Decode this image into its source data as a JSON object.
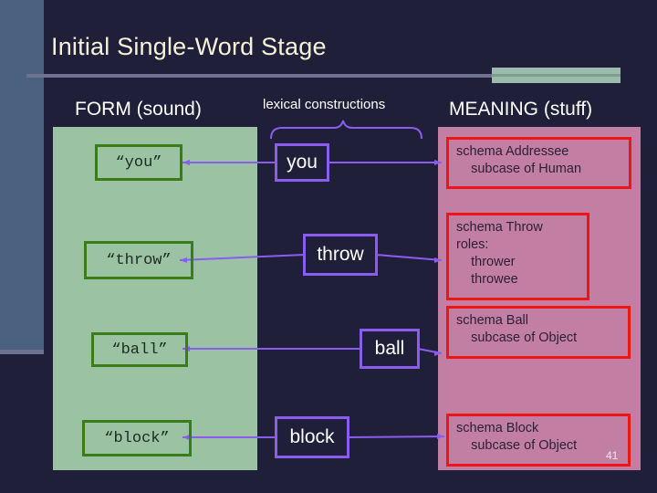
{
  "slide": {
    "title": "Initial Single-Word Stage",
    "number": "41",
    "colors": {
      "background": "#1f1f3a",
      "title_text": "#f5f2d8",
      "left_bar": "#4a6180",
      "left_bar_foot": "#6e7290",
      "title_rule": "#6e7290",
      "title_accent": "#9bbbad",
      "form_panel": "#9bc2a2",
      "meaning_panel": "#c37fa3",
      "form_box_border": "#3a7d18",
      "lexical_box_border": "#8a5cf0",
      "meaning_box_border": "#f01414",
      "connector": "#8a5cf0"
    }
  },
  "headers": {
    "form": "FORM (sound)",
    "lexical": "lexical constructions",
    "meaning": "MEANING (stuff)"
  },
  "rows": [
    {
      "form": "“you”",
      "lexical": "you",
      "meaning": "schema Addressee\n    subcase of Human"
    },
    {
      "form": "“throw”",
      "lexical": "throw",
      "meaning": "schema Throw\nroles:\n    thrower\n    throwee"
    },
    {
      "form": "“ball”",
      "lexical": "ball",
      "meaning": "schema Ball\n    subcase of Object"
    },
    {
      "form": "“block”",
      "lexical": "block",
      "meaning": "schema Block\n    subcase of Object"
    }
  ]
}
